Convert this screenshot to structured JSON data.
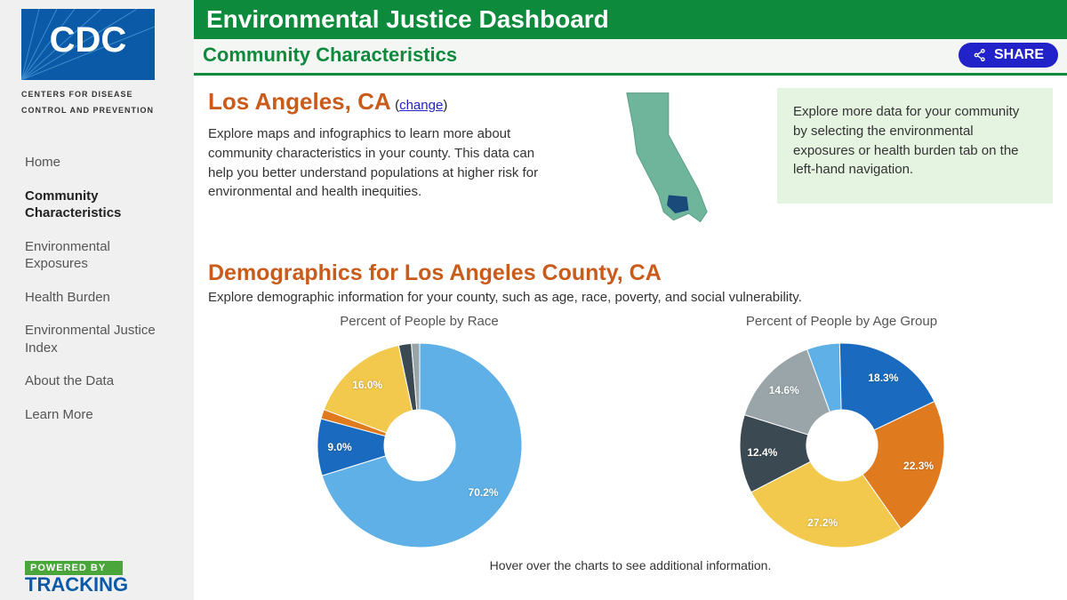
{
  "logo": {
    "line1": "CENTERS FOR DISEASE",
    "line2": "CONTROL AND PREVENTION"
  },
  "nav": {
    "items": [
      {
        "label": "Home"
      },
      {
        "label": "Community Characteristics"
      },
      {
        "label": "Environmental Exposures"
      },
      {
        "label": "Health Burden"
      },
      {
        "label": "Environmental Justice Index"
      },
      {
        "label": "About the Data"
      },
      {
        "label": "Learn More"
      }
    ],
    "active_index": 1
  },
  "tracking": {
    "powered_by": "POWERED BY",
    "name": "TRACKING"
  },
  "header": {
    "title": "Environmental Justice Dashboard",
    "subtitle": "Community Characteristics",
    "share_label": "SHARE"
  },
  "intro": {
    "location": "Los Angeles, CA",
    "change_text": "change",
    "body": "Explore maps and infographics to learn more about community characteristics in your county. This data can help you better understand populations at higher risk for environmental and health inequities."
  },
  "callout": "Explore more data for your community by selecting the environmental exposures or health burden tab on the left-hand navigation.",
  "demo": {
    "title": "Demographics for Los Angeles County, CA",
    "subtitle": "Explore demographic information for your county, such as age, race, poverty, and social vulnerability.",
    "hover_note": "Hover over the charts to see additional information."
  },
  "chart_data": [
    {
      "type": "pie",
      "title": "Percent of People by Race",
      "labels_shown": [
        "70.2%",
        "9.0%",
        "16.0%"
      ],
      "series": [
        {
          "name": "slice-1",
          "value": 70.2,
          "color": "#5fb0e6"
        },
        {
          "name": "slice-2",
          "value": 9.0,
          "color": "#1a6bbf"
        },
        {
          "name": "slice-3",
          "value": 1.5,
          "color": "#e07a1e"
        },
        {
          "name": "slice-4",
          "value": 16.0,
          "color": "#f2c94c"
        },
        {
          "name": "slice-5",
          "value": 2.0,
          "color": "#3b4a52"
        },
        {
          "name": "slice-6",
          "value": 1.3,
          "color": "#9aa5aa"
        }
      ]
    },
    {
      "type": "pie",
      "title": "Percent of People by Age Group",
      "labels_shown": [
        "18.3%",
        "22.3%",
        "27.2%",
        "12.4%",
        "14.6%"
      ],
      "series": [
        {
          "name": "age-1",
          "value": 5.2,
          "color": "#5fb0e6"
        },
        {
          "name": "age-2",
          "value": 18.3,
          "color": "#1a6bbf"
        },
        {
          "name": "age-3",
          "value": 22.3,
          "color": "#e07a1e"
        },
        {
          "name": "age-4",
          "value": 27.2,
          "color": "#f2c94c"
        },
        {
          "name": "age-5",
          "value": 12.4,
          "color": "#3b4a52"
        },
        {
          "name": "age-6",
          "value": 14.6,
          "color": "#9aa5aa"
        }
      ]
    }
  ]
}
